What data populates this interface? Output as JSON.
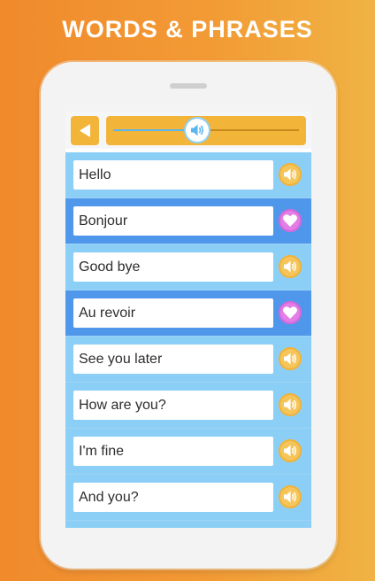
{
  "headline": "WORDS & PHRASES",
  "toolbar": {
    "back_icon": "back-arrow-icon",
    "audio_icon": "speaker-icon",
    "audio_progress": 0.45,
    "colors": {
      "bar": "#f3b43a",
      "progress": "#5ab6ee"
    }
  },
  "phrases": [
    {
      "text": "Hello",
      "kind": "en",
      "icon": "speaker-icon"
    },
    {
      "text": "Bonjour",
      "kind": "fr",
      "icon": "heart-icon"
    },
    {
      "text": "Good bye",
      "kind": "en",
      "icon": "speaker-icon"
    },
    {
      "text": "Au revoir",
      "kind": "fr",
      "icon": "heart-icon"
    },
    {
      "text": "See you later",
      "kind": "en",
      "icon": "speaker-icon"
    },
    {
      "text": "How are you?",
      "kind": "en",
      "icon": "speaker-icon"
    },
    {
      "text": "I'm fine",
      "kind": "en",
      "icon": "speaker-icon"
    },
    {
      "text": "And you?",
      "kind": "en",
      "icon": "speaker-icon"
    },
    {
      "text": "",
      "kind": "en",
      "icon": ""
    }
  ],
  "colors": {
    "background_start": "#f08a2c",
    "background_end": "#f0b344",
    "row_light": "#8ccff6",
    "row_dark": "#4f97ea",
    "sound_button": "#f6c55a",
    "heart_button": "#e27ee6"
  }
}
